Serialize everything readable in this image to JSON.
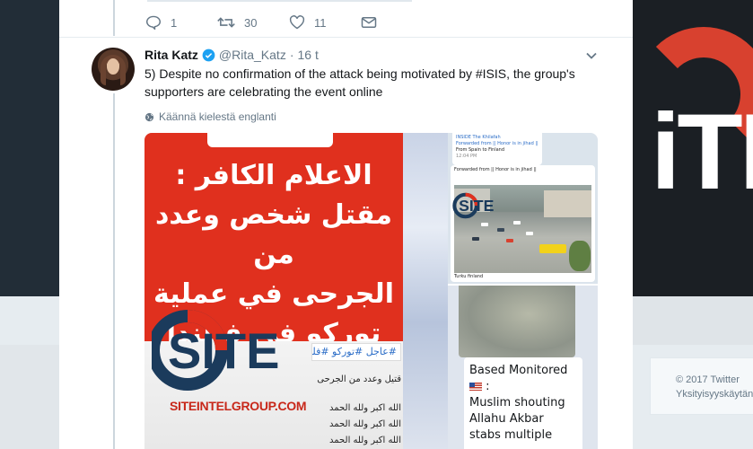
{
  "prev_tweet": {
    "actions": [
      {
        "name": "reply",
        "count": "1"
      },
      {
        "name": "retweet",
        "count": "30"
      },
      {
        "name": "like",
        "count": "11"
      },
      {
        "name": "message",
        "count": ""
      }
    ]
  },
  "tweet": {
    "name": "Rita Katz",
    "handle": "@Rita_Katz",
    "separator": "·",
    "time": "16 t",
    "text": "5) Despite no confirmation of the attack being motivated by #ISIS, the group's supporters are celebrating the event online",
    "translate_label": "Käännä kielestä englanti"
  },
  "media": {
    "left_image": {
      "arabic_headline": [
        "الاعلام الكافر :",
        "مقتل شخص وعدد من",
        "الجرحى في عملية",
        "توركو في فنلندا"
      ],
      "hashtags": "#عاجل #توركو #فلندا",
      "lines": [
        "قتيل وعدد من الجرحى",
        "الله اكبر ولله الحمد",
        "الله اكبر ولله الحمد",
        "الله اكبر ولله الحمد"
      ],
      "site_url": "SITEINTELGROUP.COM"
    },
    "top_right_image": {
      "channel": "INSIDE The Khilafah",
      "forwarded": "Forwarded from || Honor is in jihad ||",
      "top_time": "12:04 PM",
      "spain_text": "From Spain to Finland",
      "header_line": "Forwarded from || Honor is in jihad ||",
      "caption": "Turku finland"
    },
    "bottom_right_image": {
      "line1": "Based Monitored",
      "line2": "Muslim shouting",
      "line3": "Allahu Akbar",
      "line4": "stabs multiple"
    }
  },
  "footer": {
    "copyright": "© 2017 Twitter",
    "privacy": "Yksityisyyskäytän"
  },
  "colors": {
    "accent": "#1da1f2",
    "site_red": "#e0301e",
    "muted": "#657786"
  }
}
